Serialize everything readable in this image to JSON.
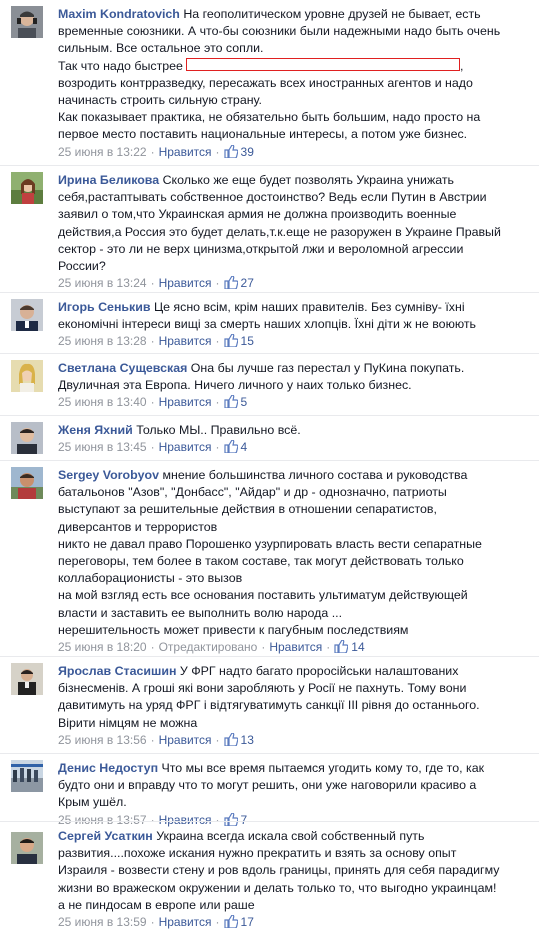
{
  "separator": "·",
  "comments": [
    {
      "author": "Maxim Kondratovich",
      "lines": [
        "На геополитическом уровне друзей не бывает, есть",
        "временные союзники. А что-бы союзники были надежными надо быть очень",
        "сильным. Все остальное это сопли.",
        "Так что надо быстрее",
        "возродить контрразведку, пересажать всех иностранных агентов и надо",
        "начинасть строить сильную страну.",
        "Как показывает практика, не обязательно быть большим, надо просто на",
        "первое место поставить национальные интересы, а потом уже бизнес."
      ],
      "after_box": ",",
      "date": "25 июня в 13:22",
      "like": "Нравится",
      "likes": "39"
    },
    {
      "author": "Ирина Беликова",
      "lines": [
        "Сколько же еще будет позволять Украина унижать",
        "себя,растаптывать собственное достоинство? Ведь если Путин в Австрии",
        "заявил о том,что Украинская армия не должна производить военные",
        "действия,а Россия это будет делать,т.к.еще не разоружен в Украине Правый",
        "сектор - это ли не верх цинизма,открытой лжи и вероломной агрессии",
        "России?"
      ],
      "date": "25 июня в 13:24",
      "like": "Нравится",
      "likes": "27"
    },
    {
      "author": "Игорь Сенькив",
      "lines": [
        "Це ясно всім, крім наших правителів. Без сумніву- їхні",
        "економічні інтереси вищі за смерть наших хлопців. Їхні діти ж не воюють"
      ],
      "date": "25 июня в 13:28",
      "like": "Нравится",
      "likes": "15"
    },
    {
      "author": "Светлана Сущевская",
      "lines": [
        "Она бы лучше газ перестал у ПуКина покупать.",
        "Двуличная эта Европа. Ничего личного у наих только бизнес."
      ],
      "date": "25 июня в 13:40",
      "like": "Нравится",
      "likes": "5"
    },
    {
      "author": "Женя Яхний",
      "lines": [
        "Только МЫ.. Правильно всё."
      ],
      "date": "25 июня в 13:45",
      "like": "Нравится",
      "likes": "4"
    },
    {
      "author": "Sergey Vorobyov",
      "lines": [
        "мнение большинства личного состава и руководства",
        "батальонов \"Азов\", \"Донбасс\", \"Айдар\" и др - однозначно, патриоты",
        "выступают за решительные действия в отношении сепаратистов,",
        "диверсантов и террористов",
        "никто не давал право Порошенко узурпировать власть вести сепаратные",
        "переговоры, тем более в таком составе, так могут действовать только",
        "коллаборационисты - это вызов",
        "на мой взгляд есть все основания поставить ультиматум действующей",
        "власти и заставить ее выполнить волю народа ...",
        "нерешительность может привести к пагубным последствиям"
      ],
      "date": "25 июня в 18:20",
      "edited": "Отредактировано",
      "like": "Нравится",
      "likes": "14"
    },
    {
      "author": "Ярослав Стасишин",
      "lines": [
        "У ФРГ надто багато проросійськи налаштованих",
        "бізнесменів. А гроші які вони заробляють у Росії не пахнуть. Тому вони",
        "давитимуть на уряд ФРГ і відтягуватимуть санкції ІІІ рівня до останнього.",
        "Вірити німцям не можна"
      ],
      "date": "25 июня в 13:56",
      "like": "Нравится",
      "likes": "13"
    },
    {
      "author": "Денис Недоступ",
      "lines": [
        "Что мы все время пытаемся угодить кому то, где то, как",
        "будто они и вправду что то могут решить, они уже наговорили красиво а",
        "Крым ушёл."
      ],
      "date": "25 июня в 13:57",
      "like": "Нравится",
      "likes": "7"
    },
    {
      "author": "Сергей Усаткин",
      "lines": [
        "Украина всегда искала свой собственный путь",
        "развития....похоже искания нужно прекратить и взять за основу опыт",
        "Израиля - возвести стену и ров вдоль границы, принять для себя парадигму",
        "жизни во вражеском окружении и делать только то, что выгодно украинцам!",
        "а не пиндосам в европе или раше"
      ],
      "date": "25 июня в 13:59",
      "like": "Нравится",
      "likes": "17"
    }
  ]
}
